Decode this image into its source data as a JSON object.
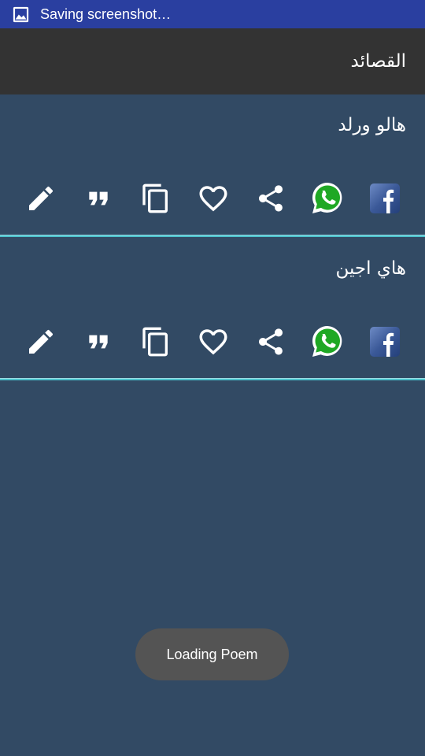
{
  "status_bar": {
    "text": "Saving screenshot…",
    "icon": "image-icon",
    "color": "#2a3fa0"
  },
  "app_bar": {
    "title": "القصائد",
    "color": "#333333"
  },
  "poems": [
    {
      "title": "هالو ورلد"
    },
    {
      "title": "هاي اجين"
    }
  ],
  "actions": [
    "edit-icon",
    "quote-icon",
    "copy-icon",
    "favorite-icon",
    "share-icon",
    "whatsapp-icon",
    "facebook-icon"
  ],
  "toast": {
    "text": "Loading Poem"
  },
  "colors": {
    "background": "#324a64",
    "divider": "#4fd0d8",
    "whatsapp": "#1fa824",
    "facebook": "#3b5998"
  }
}
